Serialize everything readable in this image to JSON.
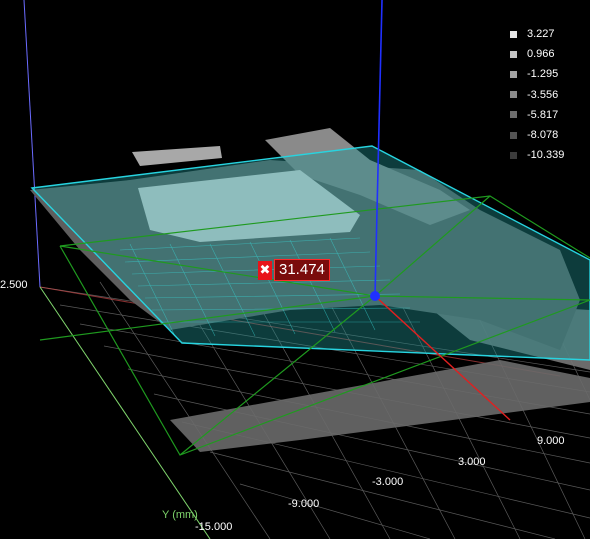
{
  "legend": [
    {
      "label": "3.227",
      "color": "#e6e6e6"
    },
    {
      "label": "0.966",
      "color": "#c4c4c4"
    },
    {
      "label": "-1.295",
      "color": "#a3a3a3"
    },
    {
      "label": "-3.556",
      "color": "#8a8a8a"
    },
    {
      "label": "-5.817",
      "color": "#6e6e6e"
    },
    {
      "label": "-8.078",
      "color": "#545454"
    },
    {
      "label": "-10.339",
      "color": "#3b3b3b"
    }
  ],
  "measurement": {
    "icon": "close-icon",
    "value": "31.474",
    "color": "#e8141a"
  },
  "axes": {
    "y_title": "Y (mm)",
    "y_ticks": [
      "-15.000",
      "-9.000",
      "-3.000",
      "3.000",
      "9.000"
    ],
    "z_tick": "2.500"
  },
  "colors": {
    "plane": "#27d4e0",
    "bbox": "#1f9a1f",
    "x_axis": "#e02020",
    "z_axis": "#2030ff",
    "y_axis": "#7dd36a"
  }
}
